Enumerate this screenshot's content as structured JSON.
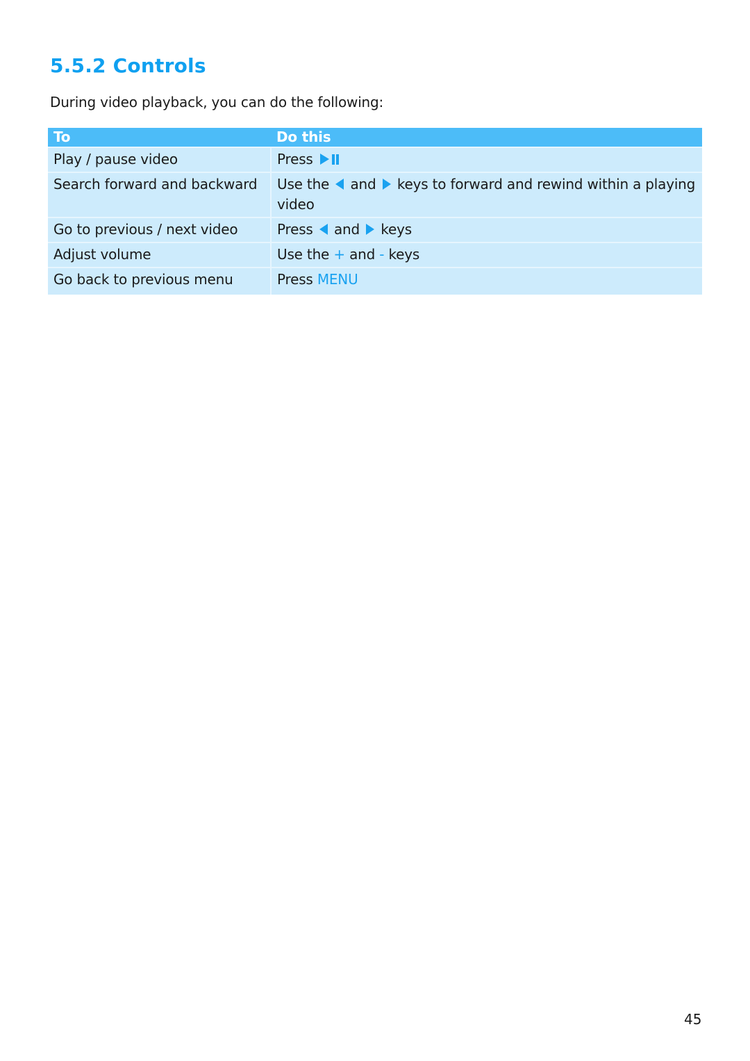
{
  "section": {
    "heading": "5.5.2 Controls",
    "intro": "During video playback, you can do the following:"
  },
  "table": {
    "headers": {
      "to": "To",
      "do_this": "Do this"
    },
    "rows": [
      {
        "to": "Play / pause video",
        "do_this": {
          "prefix": "Press",
          "icon": "play-pause-icon"
        }
      },
      {
        "to": "Search forward and backward",
        "do_this": {
          "prefix": "Use the",
          "icon1": "left-triangle-icon",
          "middle": "and",
          "icon2": "right-triangle-icon",
          "suffix": "keys to forward and rewind within a playing video"
        }
      },
      {
        "to": "Go to previous / next video",
        "do_this": {
          "prefix": "Press",
          "icon1": "left-triangle-icon",
          "middle": "and",
          "icon2": "right-triangle-icon",
          "suffix": "keys"
        }
      },
      {
        "to": "Adjust volume",
        "do_this": {
          "prefix": "Use the",
          "key1": "+",
          "middle": "and",
          "key2": "-",
          "suffix": "keys"
        }
      },
      {
        "to": "Go back to previous menu",
        "do_this": {
          "prefix": "Press",
          "key": "MENU"
        }
      }
    ]
  },
  "footer": {
    "page_number": "45"
  },
  "colors": {
    "heading": "#0fa0f0",
    "header_bg": "#4cbcf8",
    "row_bg": "#cdebfc",
    "accent": "#1aa2f0"
  }
}
